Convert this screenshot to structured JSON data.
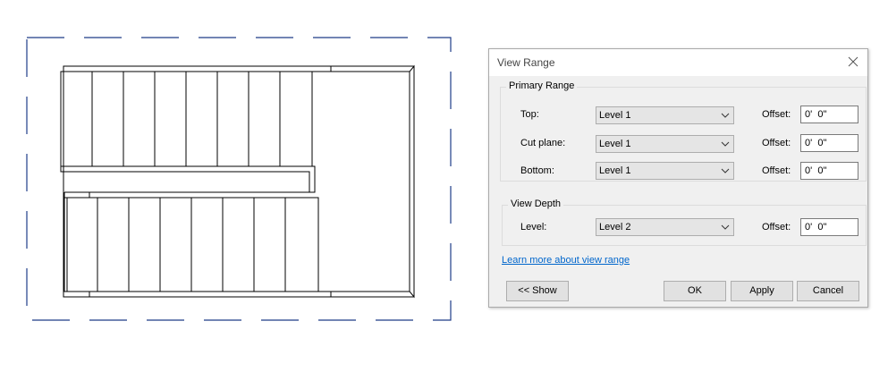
{
  "dialog": {
    "title": "View Range",
    "primary_range": {
      "legend": "Primary Range",
      "rows": [
        {
          "label": "Top:",
          "level": "Level 1",
          "offset_label": "Offset:",
          "offset": "0'  0\""
        },
        {
          "label": "Cut plane:",
          "level": "Level 1",
          "offset_label": "Offset:",
          "offset": "0'  0\""
        },
        {
          "label": "Bottom:",
          "level": "Level 1",
          "offset_label": "Offset:",
          "offset": "0'  0\""
        }
      ]
    },
    "view_depth": {
      "legend": "View Depth",
      "label": "Level:",
      "level": "Level 2",
      "offset_label": "Offset:",
      "offset": "0'  0\""
    },
    "link": "Learn more about view range",
    "buttons": {
      "show": "<< Show",
      "ok": "OK",
      "apply": "Apply",
      "cancel": "Cancel"
    }
  },
  "colors": {
    "crop_boundary": "#1f3c88",
    "link": "#0066cc"
  },
  "icons": [
    "close-icon",
    "chevron-down-icon"
  ]
}
